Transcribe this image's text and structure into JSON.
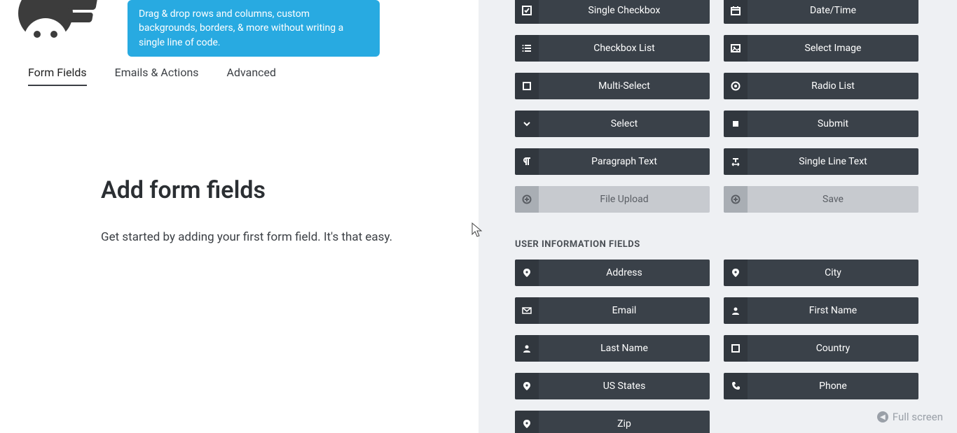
{
  "tooltip": "Drag & drop rows and columns, custom backgrounds, borders, & more without writing a single line of code.",
  "tabs": {
    "form_fields": "Form Fields",
    "emails_actions": "Emails & Actions",
    "advanced": "Advanced"
  },
  "left": {
    "heading": "Add form fields",
    "body": "Get started by adding your first form field. It's that easy."
  },
  "common_fields": [
    {
      "label": "Single Checkbox",
      "icon": "check-square",
      "disabled": false
    },
    {
      "label": "Date/Time",
      "icon": "calendar",
      "disabled": false
    },
    {
      "label": "Checkbox List",
      "icon": "list",
      "disabled": false
    },
    {
      "label": "Select Image",
      "icon": "image",
      "disabled": false
    },
    {
      "label": "Multi-Select",
      "icon": "square",
      "disabled": false
    },
    {
      "label": "Radio List",
      "icon": "dot-circle",
      "disabled": false
    },
    {
      "label": "Select",
      "icon": "chevron-down",
      "disabled": false
    },
    {
      "label": "Submit",
      "icon": "square-filled",
      "disabled": false
    },
    {
      "label": "Paragraph Text",
      "icon": "paragraph",
      "disabled": false
    },
    {
      "label": "Single Line Text",
      "icon": "text-width",
      "disabled": false
    },
    {
      "label": "File Upload",
      "icon": "plus-circle",
      "disabled": true
    },
    {
      "label": "Save",
      "icon": "plus-circle",
      "disabled": true
    }
  ],
  "user_section_heading": "USER INFORMATION FIELDS",
  "user_fields": [
    {
      "label": "Address",
      "icon": "map-marker"
    },
    {
      "label": "City",
      "icon": "map-marker"
    },
    {
      "label": "Email",
      "icon": "envelope"
    },
    {
      "label": "First Name",
      "icon": "user"
    },
    {
      "label": "Last Name",
      "icon": "user"
    },
    {
      "label": "Country",
      "icon": "square"
    },
    {
      "label": "US States",
      "icon": "map-marker"
    },
    {
      "label": "Phone",
      "icon": "phone"
    },
    {
      "label": "Zip",
      "icon": "map-marker"
    }
  ],
  "fullscreen_label": "Full screen"
}
